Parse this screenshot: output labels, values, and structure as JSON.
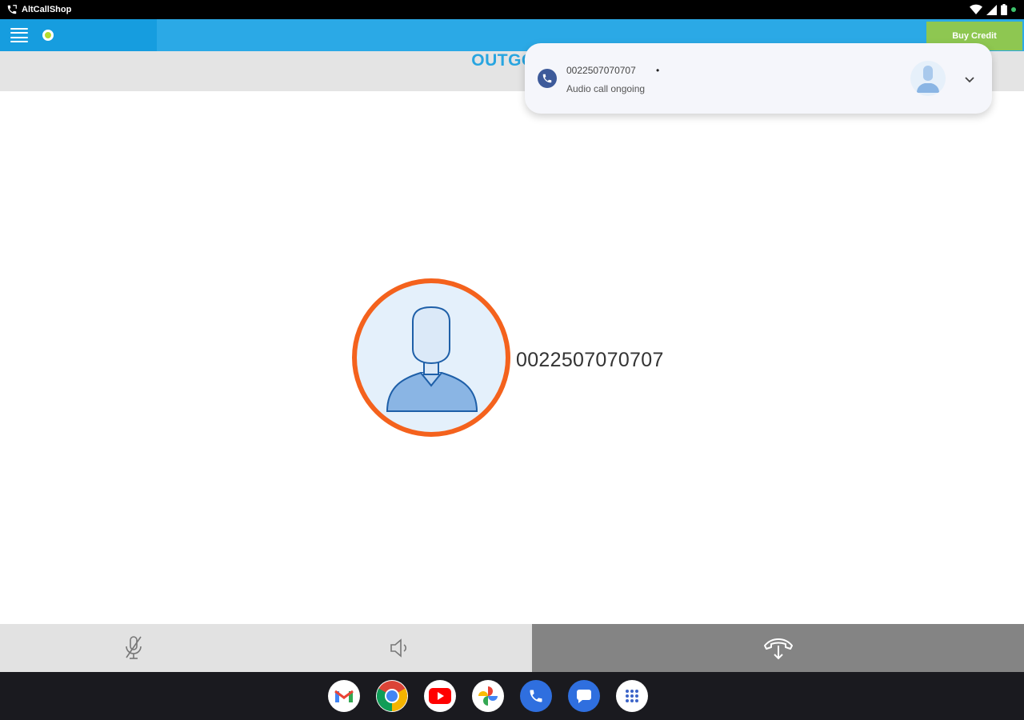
{
  "status_bar": {
    "app_name": "AltCallShop",
    "icons": [
      "call-ongoing-icon",
      "wifi-icon",
      "signal-icon",
      "battery-icon",
      "dot-indicator-icon"
    ]
  },
  "header": {
    "menu_icon": "hamburger-menu-icon",
    "online_status_color": "#b6dc2c",
    "buy_credit_label": "Buy Credit",
    "brand_color": "#2ba9e6"
  },
  "call": {
    "title": "OUTGOIN",
    "number": "0022507070707",
    "avatar_icon": "person-avatar-icon",
    "ring_color": "#f4621d"
  },
  "controls": [
    {
      "name": "mute",
      "icon": "microphone-off-icon"
    },
    {
      "name": "speaker",
      "icon": "speaker-icon"
    },
    {
      "name": "hangup",
      "icon": "hang-up-icon"
    }
  ],
  "notification": {
    "title": "0022507070707",
    "bullet": "•",
    "text": "Audio call ongoing",
    "icon": "phone-icon",
    "avatar_icon": "person-avatar-icon",
    "expand_icon": "chevron-down-icon"
  },
  "dock": [
    {
      "name": "gmail",
      "icon": "gmail-icon"
    },
    {
      "name": "chrome",
      "icon": "chrome-icon"
    },
    {
      "name": "youtube",
      "icon": "youtube-icon"
    },
    {
      "name": "photos",
      "icon": "photos-icon"
    },
    {
      "name": "phone",
      "icon": "phone-icon"
    },
    {
      "name": "messages",
      "icon": "messages-icon"
    },
    {
      "name": "app-drawer",
      "icon": "app-drawer-icon"
    }
  ]
}
